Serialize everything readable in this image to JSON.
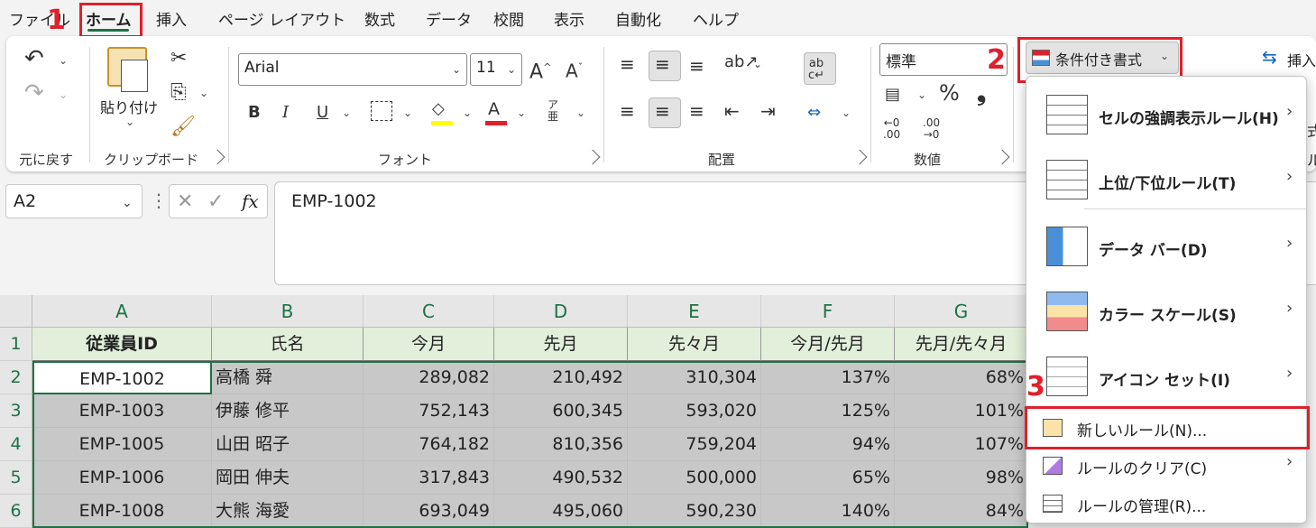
{
  "tabs": [
    "ファイル",
    "ホーム",
    "挿入",
    "ページ レイアウト",
    "数式",
    "データ",
    "校閲",
    "表示",
    "自動化",
    "ヘルプ"
  ],
  "annotations": {
    "step1": "1",
    "step2": "2",
    "step3": "3"
  },
  "ribbon": {
    "undo_group_label": "元に戻す",
    "paste_label": "貼り付け",
    "clipboard_label": "クリップボード",
    "font_name": "Arial",
    "font_size": "11",
    "font_label": "フォント",
    "bold": "B",
    "italic": "I",
    "underline": "U",
    "align_label": "配置",
    "number_format": "標準",
    "number_label": "数値",
    "percent": "%",
    "comma": "❟",
    "cf_button": "条件付き書式",
    "insert_button": "挿入",
    "cut_off_1": "式",
    "cut_off_2": "ル"
  },
  "formula_bar": {
    "name_box": "A2",
    "fx": "fx",
    "value": "EMP-1002"
  },
  "columns": [
    "A",
    "B",
    "C",
    "D",
    "E",
    "F",
    "G"
  ],
  "rows": [
    "1",
    "2",
    "3",
    "4",
    "5",
    "6"
  ],
  "header_row": [
    "従業員ID",
    "氏名",
    "今月",
    "先月",
    "先々月",
    "今月/先月",
    "先月/先々月"
  ],
  "data_rows": [
    [
      "EMP-1002",
      "高橋 舜",
      "289,082",
      "210,492",
      "310,304",
      "137%",
      "68%"
    ],
    [
      "EMP-1003",
      "伊藤 修平",
      "752,143",
      "600,345",
      "593,020",
      "125%",
      "101%"
    ],
    [
      "EMP-1005",
      "山田 昭子",
      "764,182",
      "810,356",
      "759,204",
      "94%",
      "107%"
    ],
    [
      "EMP-1006",
      "岡田 伸夫",
      "317,843",
      "490,532",
      "500,000",
      "65%",
      "98%"
    ],
    [
      "EMP-1008",
      "大熊 海愛",
      "693,049",
      "495,060",
      "590,230",
      "140%",
      "84%"
    ]
  ],
  "cf_menu": {
    "items": [
      {
        "label": "セルの強調表示ルール(H)",
        "shortcut": "H",
        "has_submenu": true
      },
      {
        "label": "上位/下位ルール(T)",
        "shortcut": "T",
        "has_submenu": true
      },
      {
        "label": "データ バー(D)",
        "shortcut": "D",
        "has_submenu": true
      },
      {
        "label": "カラー スケール(S)",
        "shortcut": "S",
        "has_submenu": true
      },
      {
        "label": "アイコン セット(I)",
        "shortcut": "I",
        "has_submenu": true
      }
    ],
    "small_items": [
      {
        "label": "新しいルール(N)...",
        "has_submenu": false
      },
      {
        "label": "ルールのクリア(C)",
        "has_submenu": true
      },
      {
        "label": "ルールの管理(R)...",
        "has_submenu": false
      }
    ]
  },
  "colors": {
    "accent_green": "#1e7145",
    "annotation_red": "#e0202a",
    "header_fill": "#e2efda",
    "selection_gray": "#c8c8c8"
  }
}
